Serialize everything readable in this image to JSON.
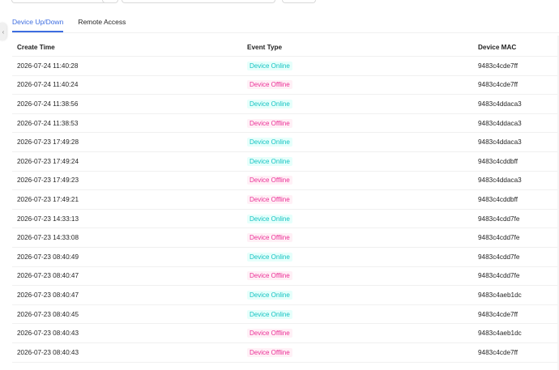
{
  "tabs": [
    {
      "label": "Device Up/Down",
      "active": true
    },
    {
      "label": "Remote Access",
      "active": false
    }
  ],
  "table": {
    "columns": [
      "Create Time",
      "Event Type",
      "Device MAC"
    ],
    "rows": [
      {
        "time": "2026-07-24 11:40:28",
        "event": "Device Online",
        "status": "online",
        "mac": "9483c4cde7ff"
      },
      {
        "time": "2026-07-24 11:40:24",
        "event": "Device Offline",
        "status": "offline",
        "mac": "9483c4cde7ff"
      },
      {
        "time": "2026-07-24 11:38:56",
        "event": "Device Online",
        "status": "online",
        "mac": "9483c4ddaca3"
      },
      {
        "time": "2026-07-24 11:38:53",
        "event": "Device Offline",
        "status": "offline",
        "mac": "9483c4ddaca3"
      },
      {
        "time": "2026-07-23 17:49:28",
        "event": "Device Online",
        "status": "online",
        "mac": "9483c4ddaca3"
      },
      {
        "time": "2026-07-23 17:49:24",
        "event": "Device Online",
        "status": "online",
        "mac": "9483c4cddbff"
      },
      {
        "time": "2026-07-23 17:49:23",
        "event": "Device Offline",
        "status": "offline",
        "mac": "9483c4ddaca3"
      },
      {
        "time": "2026-07-23 17:49:21",
        "event": "Device Offline",
        "status": "offline",
        "mac": "9483c4cddbff"
      },
      {
        "time": "2026-07-23 14:33:13",
        "event": "Device Online",
        "status": "online",
        "mac": "9483c4cdd7fe"
      },
      {
        "time": "2026-07-23 14:33:08",
        "event": "Device Offline",
        "status": "offline",
        "mac": "9483c4cdd7fe"
      },
      {
        "time": "2026-07-23 08:40:49",
        "event": "Device Online",
        "status": "online",
        "mac": "9483c4cdd7fe"
      },
      {
        "time": "2026-07-23 08:40:47",
        "event": "Device Offline",
        "status": "offline",
        "mac": "9483c4cdd7fe"
      },
      {
        "time": "2026-07-23 08:40:47",
        "event": "Device Online",
        "status": "online",
        "mac": "9483c4aeb1dc"
      },
      {
        "time": "2026-07-23 08:40:45",
        "event": "Device Online",
        "status": "online",
        "mac": "9483c4cde7ff"
      },
      {
        "time": "2026-07-23 08:40:43",
        "event": "Device Offline",
        "status": "offline",
        "mac": "9483c4aeb1dc"
      },
      {
        "time": "2026-07-23 08:40:43",
        "event": "Device Offline",
        "status": "offline",
        "mac": "9483c4cde7ff"
      }
    ]
  },
  "colors": {
    "accent": "#3d6de0",
    "online_text": "#13c2c2",
    "online_bg": "#e6fffb",
    "offline_text": "#eb2f96",
    "offline_bg": "#fff0f6"
  },
  "icons": {
    "side_handle": "chevron-left-icon"
  }
}
